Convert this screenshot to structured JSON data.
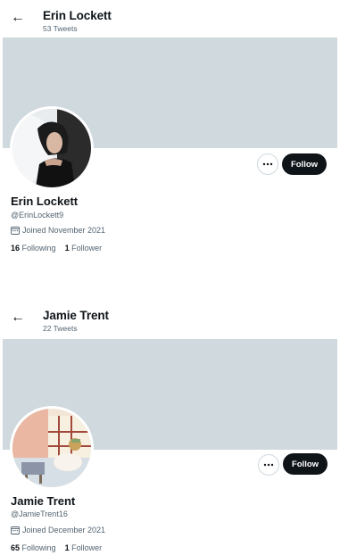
{
  "profiles": [
    {
      "header_name": "Erin Lockett",
      "tweet_count": "53 Tweets",
      "name": "Erin Lockett",
      "handle": "@ErinLockett9",
      "joined": "Joined November 2021",
      "following_count": "16",
      "following_label": "Following",
      "followers_count": "1",
      "followers_label": "Follower",
      "follow_label": "Follow"
    },
    {
      "header_name": "Jamie Trent",
      "tweet_count": "22 Tweets",
      "name": "Jamie Trent",
      "handle": "@JamieTrent16",
      "joined": "Joined December 2021",
      "following_count": "65",
      "following_label": "Following",
      "followers_count": "1",
      "followers_label": "Follower",
      "follow_label": "Follow"
    }
  ],
  "icons": {
    "back": "arrow-left-icon",
    "more": "more-horizontal-icon",
    "calendar": "calendar-icon"
  },
  "colors": {
    "banner": "#cfd9de",
    "follow_button": "#0f1419",
    "secondary_text": "#536471"
  }
}
